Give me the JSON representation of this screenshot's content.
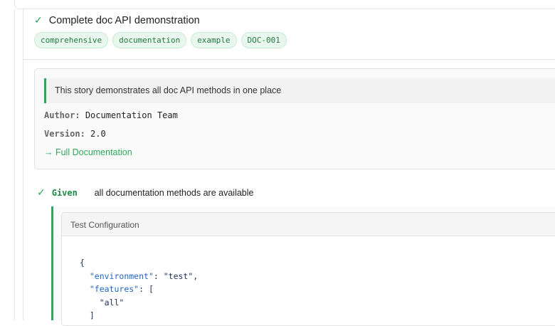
{
  "scenario": {
    "title": "Complete doc API demonstration",
    "tags": [
      "comprehensive",
      "documentation",
      "example",
      "DOC-001"
    ]
  },
  "doc": {
    "description": "This story demonstrates all doc API methods in one place",
    "author_label": "Author:",
    "author": "Documentation Team",
    "version_label": "Version:",
    "version": "2.0",
    "link": "→ Full Documentation"
  },
  "step": {
    "keyword": "Given",
    "text": "all documentation methods are available"
  },
  "attachment": {
    "title": "Test Configuration",
    "code": {
      "open": "{",
      "k1": "\"environment\"",
      "v1": ": \"test\",",
      "k2": "\"features\"",
      "v2": ": [",
      "item": "\"all\"",
      "close_arr": "]"
    }
  },
  "colors": {
    "accent": "#2ea85a"
  }
}
